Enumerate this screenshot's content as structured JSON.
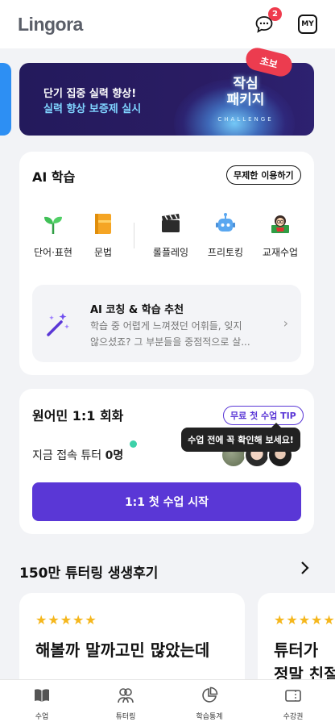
{
  "header": {
    "logo": "Lingora",
    "chat_badge": "2",
    "my_label": "MY"
  },
  "banner": {
    "line1": "단기 집중 실력 향상!",
    "line2": "실력 향상 보증제 실시",
    "title_line1": "작심",
    "title_line2": "패키지",
    "subtitle": "CHALLENGE",
    "tag": "초보"
  },
  "ai_section": {
    "title": "AI 학습",
    "unlimited_pill": "무제한 이용하기",
    "menu": [
      {
        "icon": "sprout-icon",
        "label": "단어·표현"
      },
      {
        "icon": "notebook-icon",
        "label": "문법"
      },
      {
        "icon": "clapperboard-icon",
        "label": "롤플레잉"
      },
      {
        "icon": "robot-icon",
        "label": "프리토킹"
      },
      {
        "icon": "teacher-icon",
        "label": "교재수업"
      }
    ],
    "coaching": {
      "title": "AI 코칭 & 학습 추천",
      "desc_line1": "학습 중 어렵게 느껴졌던 어휘들, 잊지",
      "desc_line2": "않으셨죠? 그 부분들을 중점적으로 살..."
    }
  },
  "tutor_section": {
    "title": "원어민 1:1 회화",
    "tip_pill": "무료 첫 수업 TIP",
    "tooltip": "수업 전에 꼭 확인해 보세요!",
    "online_prefix": "지금 접속 튜터 ",
    "online_count": "0명",
    "start_button": "1:1 첫 수업 시작"
  },
  "reviews": {
    "title": "150만 튜터링 생생후기",
    "items": [
      {
        "stars": "★★★★★",
        "text": "해볼까 말까고민 많았는데"
      },
      {
        "stars": "★★★★★",
        "text_line1": "튜터가",
        "text_line2": "정말 친절"
      }
    ]
  },
  "bottom_nav": [
    {
      "icon": "book-icon",
      "label": "수업"
    },
    {
      "icon": "people-icon",
      "label": "튜터링"
    },
    {
      "icon": "pie-chart-icon",
      "label": "학습통계"
    },
    {
      "icon": "ticket-icon",
      "label": "수강권"
    }
  ]
}
